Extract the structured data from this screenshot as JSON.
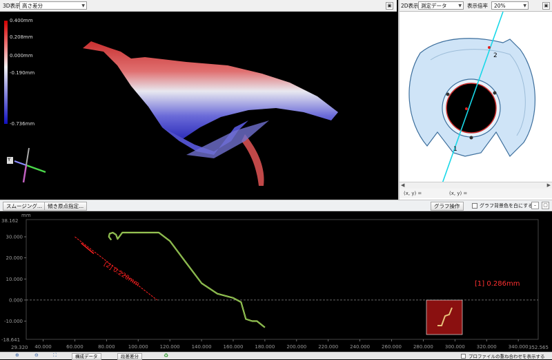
{
  "view3d": {
    "label": "3D表示",
    "mode_select": "高さ差分",
    "legend": [
      "0.400mm",
      "0.208mm",
      "0.000mm",
      "-0.190mm",
      "-0.736mm"
    ],
    "axis_label": "Y"
  },
  "view2d": {
    "label": "2D表示",
    "data_select": "測定データ",
    "scale_label": "表示倍率",
    "scale_select": "20%",
    "marker_1": "1",
    "marker_2": "2",
    "coord_readout": "(x, y) ="
  },
  "toolbar": {
    "smoothing_button": "スムージング...",
    "tilt_button": "傾き原点指定...",
    "graph_ops_button": "グラフ操作",
    "white_bg_checkbox": "グラフ背景色を白にする"
  },
  "graph": {
    "y_unit": "mm",
    "y_max_label": "38.162",
    "y_min_label": "-18.641",
    "x_min_label": "29.320",
    "x_max_label": "352.565",
    "annotation_2": "[2] 0.220mm",
    "annotation_1": "[1] 0.286mm"
  },
  "chart_data": {
    "type": "line",
    "xlabel": "",
    "ylabel": "mm",
    "xlim": [
      29.32,
      352.565
    ],
    "ylim": [
      -18.641,
      38.162
    ],
    "x_ticks": [
      "40.000",
      "60.000",
      "80.000",
      "100.000",
      "120.000",
      "140.000",
      "160.000",
      "180.000",
      "200.000",
      "220.000",
      "240.000",
      "260.000",
      "280.000",
      "300.000",
      "320.000",
      "340.000"
    ],
    "y_ticks": [
      "30.000",
      "20.000",
      "10.000",
      "0.000",
      "-10.000"
    ],
    "series": [
      {
        "x": [
          83,
          81.5,
          82,
          84,
          86,
          87,
          90,
          100,
          110,
          113,
          120,
          130,
          140,
          150,
          160,
          165,
          168,
          172,
          175,
          180
        ],
        "y": [
          28.5,
          30,
          31.5,
          32,
          31,
          29,
          32,
          32,
          32,
          32,
          28,
          18,
          8,
          3,
          1,
          -1,
          -9,
          -10,
          -10,
          -13
        ]
      }
    ],
    "annotations": [
      {
        "text": "[2] 0.220mm",
        "color": "#ff2020"
      },
      {
        "text": "[1] 0.286mm",
        "color": "#ff3030"
      }
    ]
  },
  "bottom": {
    "reverse_button": "構成データ",
    "diff_button": "段差差分",
    "profile_checkbox": "プロファイルの重ね合わせを表示する"
  }
}
